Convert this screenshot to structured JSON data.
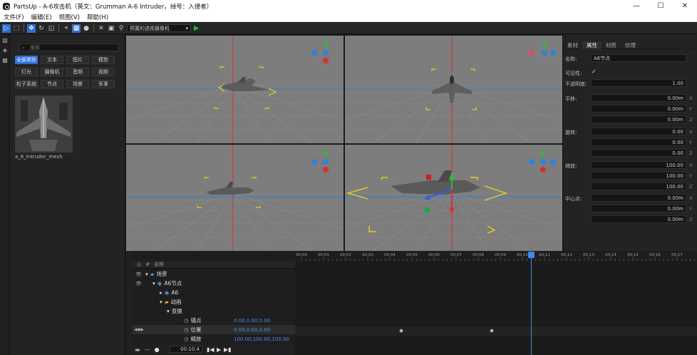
{
  "window": {
    "title": "PartsUp - A-6攻击机（英文：Grumman A-6 Intruder，绰号：入侵者）",
    "controls": [
      "—",
      "☐",
      "✕"
    ]
  },
  "menu": [
    "文件(F)",
    "编辑(E)",
    "视图(V)",
    "帮助(H)"
  ],
  "toolbar": {
    "camera_select": "预置的透视摄像机"
  },
  "library": {
    "search_placeholder": "搜索",
    "chips": [
      "全部类别",
      "文本",
      "图片",
      "模型",
      "灯光",
      "摄像机",
      "音频",
      "视频",
      "粒子系统",
      "节点",
      "场景",
      "军事"
    ],
    "active_chip": "全部类别",
    "asset_name": "a_6_Intruder_mesh"
  },
  "properties": {
    "tabs": [
      "素材",
      "属性",
      "材质",
      "纹理"
    ],
    "active_tab": "属性",
    "name_label": "名称:",
    "name_value": "A6节点",
    "visible_label": "可见性:",
    "visible_check": "✓",
    "opacity_label": "不透明度:",
    "opacity_value": "1.00",
    "translate_label": "平移:",
    "translate": [
      "0.00m",
      "0.00m",
      "0.00m"
    ],
    "rotate_label": "旋转:",
    "rotate": [
      "0.00",
      "0.00",
      "0.00"
    ],
    "scale_label": "缩放:",
    "scale": [
      "100.00",
      "100.00",
      "100.00"
    ],
    "center_label": "中心点:",
    "center": [
      "0.00m",
      "0.00m",
      "0.00m"
    ],
    "axes": [
      "X",
      "Y",
      "Z"
    ]
  },
  "timeline": {
    "header_label": "名称",
    "ticks": [
      "00:00",
      "00:01",
      "00:02",
      "00:03",
      "00:04",
      "00:05",
      "00:06",
      "00:07",
      "00:08",
      "00:09",
      "00:10",
      "00:11",
      "00:12",
      "00:13",
      "00:14",
      "00:15",
      "00:16",
      "00:17"
    ],
    "tree": [
      {
        "label": "场景",
        "value": ""
      },
      {
        "label": "A6节点",
        "value": ""
      },
      {
        "label": "A6",
        "value": ""
      },
      {
        "label": "动画",
        "value": ""
      },
      {
        "label": "变换",
        "value": ""
      },
      {
        "label": "锚点",
        "value": "0.00,0.00,0.00"
      },
      {
        "label": "位置",
        "value": "0.00,0.00,0.00"
      },
      {
        "label": "缩放",
        "value": "100.00,100.00,100.00"
      }
    ],
    "current_time": "00:10.4",
    "playhead_seconds": 10.4,
    "keyframes_seconds": [
      4.5,
      8.6
    ]
  },
  "colors": {
    "accent": "#2f6fd6",
    "axis_x": "#d83030",
    "axis_y": "#2fb83c",
    "axis_z": "#2f7fe0",
    "selection": "#e6d21a"
  }
}
